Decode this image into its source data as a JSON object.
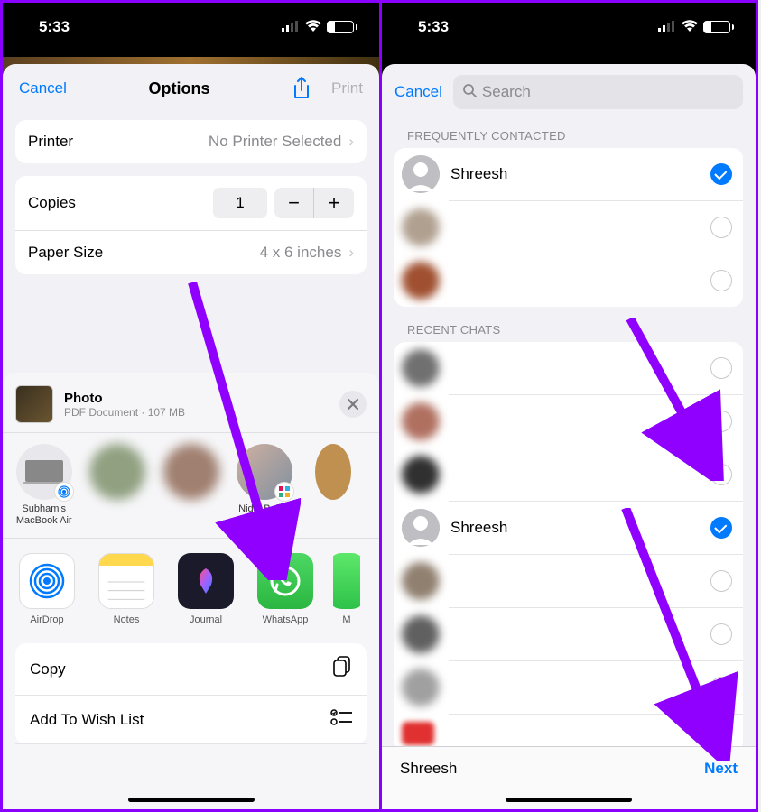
{
  "status": {
    "time": "5:33",
    "battery": "29"
  },
  "left": {
    "nav": {
      "cancel": "Cancel",
      "title": "Options",
      "print": "Print"
    },
    "printer": {
      "label": "Printer",
      "value": "No Printer Selected"
    },
    "copies": {
      "label": "Copies",
      "value": "1"
    },
    "paper": {
      "label": "Paper Size",
      "value": "4 x 6 inches"
    },
    "share": {
      "title": "Photo",
      "subtitle": "PDF Document · 107 MB",
      "people": [
        {
          "label": "Subham's MacBook Air"
        },
        {
          "label": ""
        },
        {
          "label": ""
        },
        {
          "label": "Nidhi Bohra"
        }
      ],
      "apps": [
        {
          "label": "AirDrop"
        },
        {
          "label": "Notes"
        },
        {
          "label": "Journal"
        },
        {
          "label": "WhatsApp"
        },
        {
          "label": "M"
        }
      ],
      "actions": {
        "copy": "Copy",
        "wishlist": "Add To Wish List"
      }
    }
  },
  "right": {
    "cancel": "Cancel",
    "search_placeholder": "Search",
    "freq_header": "FREQUENTLY CONTACTED",
    "recent_header": "RECENT CHATS",
    "contact_shreesh": "Shreesh",
    "selected_name": "Shreesh",
    "next": "Next"
  }
}
